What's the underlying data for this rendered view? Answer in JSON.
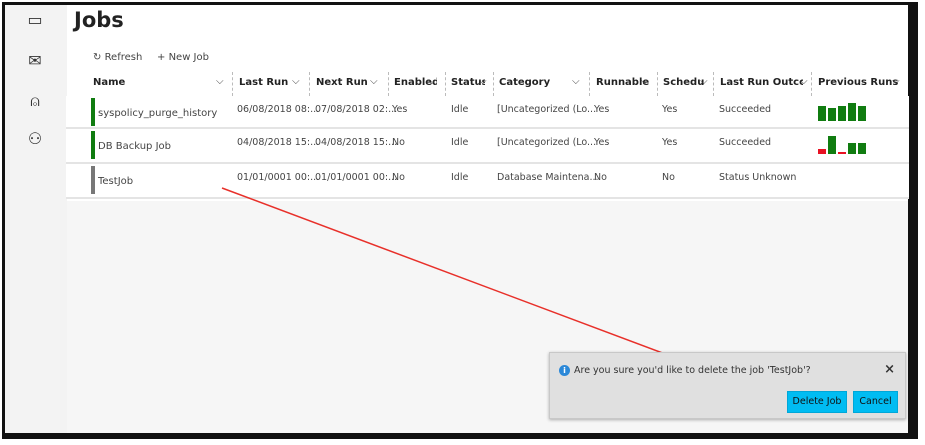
{
  "page": {
    "title": "Jobs"
  },
  "sidebar": {
    "icons": [
      "jobs-icon",
      "alerts-icon",
      "operators-icon",
      "proxies-icon"
    ]
  },
  "toolbar": {
    "refresh_label": "Refresh",
    "new_job_label": "New Job"
  },
  "columns": [
    "Name",
    "Last Run",
    "Next Run",
    "Enabled",
    "Status",
    "Category",
    "Runnable",
    "Schedule",
    "Last Run Outcome",
    "Previous Runs"
  ],
  "rows": [
    {
      "name": "syspolicy_purge_history",
      "last_run": "06/08/2018 08:...",
      "next_run": "07/08/2018 02:...",
      "enabled": "Yes",
      "status": "Idle",
      "category": "[Uncategorized (Lo...",
      "runnable": "Yes",
      "schedule": "Yes",
      "outcome": "Succeeded",
      "indicator": "#107c10",
      "previous_runs": [
        {
          "h": 0.85,
          "c": "#107c10"
        },
        {
          "h": 0.7,
          "c": "#107c10"
        },
        {
          "h": 0.85,
          "c": "#107c10"
        },
        {
          "h": 1,
          "c": "#107c10"
        },
        {
          "h": 0.85,
          "c": "#107c10"
        }
      ]
    },
    {
      "name": "DB Backup Job",
      "last_run": "04/08/2018 15:...",
      "next_run": "04/08/2018 15:...",
      "enabled": "No",
      "status": "Idle",
      "category": "[Uncategorized (Lo...",
      "runnable": "Yes",
      "schedule": "Yes",
      "outcome": "Succeeded",
      "indicator": "#107c10",
      "previous_runs": [
        {
          "h": 0.3,
          "c": "#e81123"
        },
        {
          "h": 1,
          "c": "#107c10"
        },
        {
          "h": 0.12,
          "c": "#e81123"
        },
        {
          "h": 0.6,
          "c": "#107c10"
        },
        {
          "h": 0.6,
          "c": "#107c10"
        }
      ]
    },
    {
      "name": "TestJob",
      "last_run": "01/01/0001 00:...",
      "next_run": "01/01/0001 00:...",
      "enabled": "No",
      "status": "Idle",
      "category": "Database Maintena...",
      "runnable": "No",
      "schedule": "No",
      "outcome": "Status Unknown",
      "indicator": "#777777",
      "previous_runs": []
    }
  ],
  "dialog": {
    "message": "Are you sure you'd like to delete the job 'TestJob'?",
    "delete_label": "Delete Job",
    "cancel_label": "Cancel",
    "close": "×"
  },
  "annotation_color": "#e8302a"
}
